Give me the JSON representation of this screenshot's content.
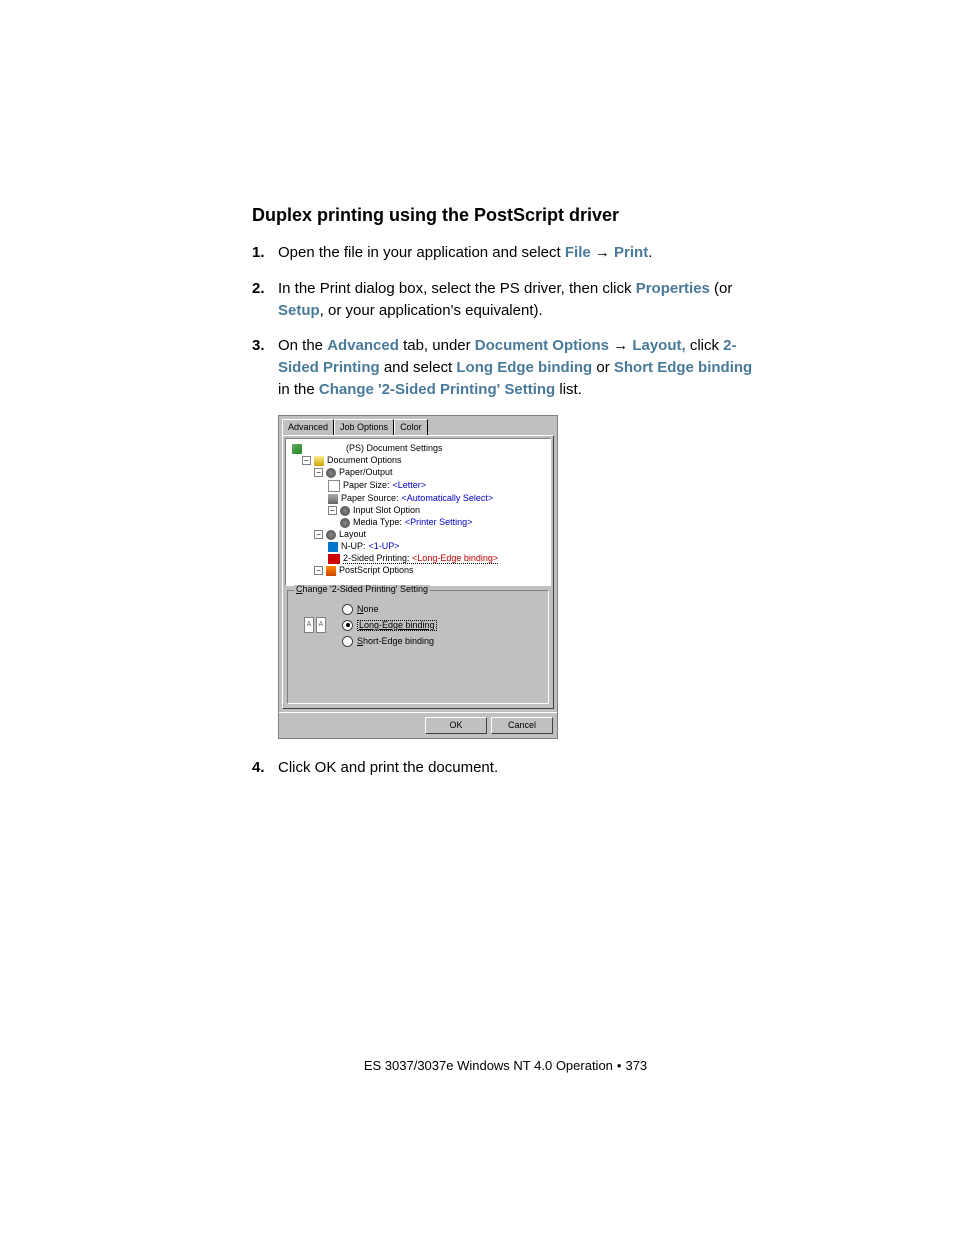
{
  "heading": "Duplex printing using the PostScript driver",
  "steps": {
    "s1": {
      "num": "1.",
      "t1": "Open the file in your application and select ",
      "file": "File",
      "arrow": " → ",
      "print": "Print",
      "end": "."
    },
    "s2": {
      "num": "2.",
      "t1": "In the Print dialog box, select the  PS driver, then click ",
      "properties": "Properties",
      "t2": " (or ",
      "setup": "Setup",
      "t3": ", or your application's equivalent)."
    },
    "s3": {
      "num": "3.",
      "t1": "On the ",
      "advanced": "Advanced",
      "t2": " tab, under ",
      "docopt": "Document Options",
      "arrow": " → ",
      "layout": "Layout,",
      "t3": " click ",
      "twosided": "2-Sided Printing",
      "t4": " and select ",
      "longedge": "Long Edge binding",
      "t5": " or ",
      "shortedge": "Short Edge binding",
      "t6": " in the ",
      "changeset": "Change '2-Sided Printing' Setting",
      "t7": " list."
    },
    "s4": {
      "num": "4.",
      "t1": "Click OK and print the document."
    }
  },
  "dialog": {
    "tabs": {
      "advanced": "Advanced",
      "joboptions": "Job Options",
      "color": "Color"
    },
    "tree": {
      "root": "(PS) Document Settings",
      "docopt": "Document Options",
      "paperout": "Paper/Output",
      "papersize_l": "Paper Size: ",
      "papersize_v": "<Letter>",
      "papersrc_l": "Paper Source: ",
      "papersrc_v": "<Automatically Select>",
      "inputslot": "Input Slot Option",
      "mediatype_l": "Media Type: ",
      "mediatype_v": "<Printer Setting>",
      "layout": "Layout",
      "nup_l": "N-UP: ",
      "nup_v": "<1-UP>",
      "twosided_l": "2-Sided Printing: ",
      "twosided_v": "<Long-Edge binding>",
      "psopt": "PostScript Options"
    },
    "group": {
      "label_c": "C",
      "label_rest": "hange '2-Sided Printing' Setting",
      "none_u": "N",
      "none_rest": "one",
      "long_u": "L",
      "long_rest": "ong-Edge binding",
      "short_u": "S",
      "short_rest": "hort-Edge binding"
    },
    "buttons": {
      "ok": "OK",
      "cancel": "Cancel"
    }
  },
  "footer": {
    "left": "ES 3037/3037e Windows NT 4.0 Operation",
    "page": "373"
  }
}
